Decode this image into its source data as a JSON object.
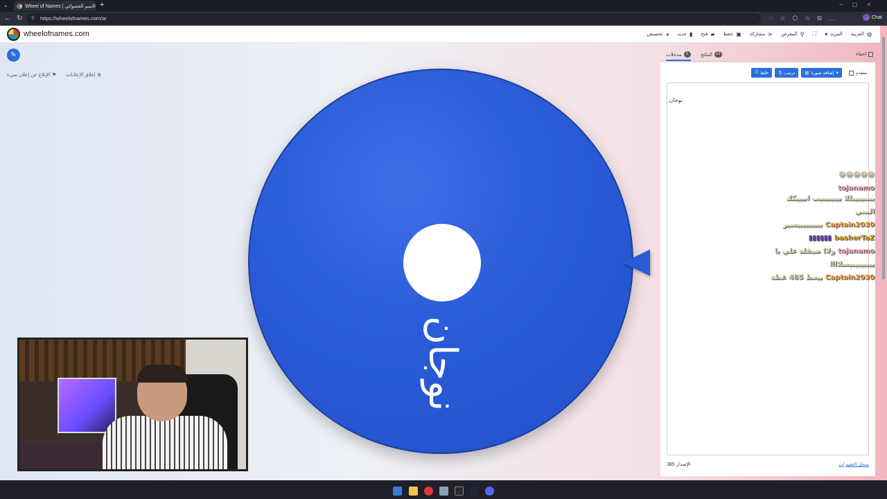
{
  "browser": {
    "tab_title": "Wheel of Names | الاسم العشوائي",
    "url": "https://wheelofnames.com/ar",
    "chat_label": "Chat"
  },
  "site": {
    "brand": "wheelofnames.com",
    "menu": [
      "تخصيص",
      "جديد",
      "فتح",
      "حفظ",
      "مشاركة",
      "المعرض",
      "المزيد",
      "العربية"
    ],
    "ad_close": "إغلاق الإعلانات",
    "ad_report": "الإبلاغ عن إعلان سيء"
  },
  "wheel": {
    "entry_label": "نوجان",
    "color": "#2a5bd7"
  },
  "panel": {
    "tab_entries": "مدخلات",
    "tab_entries_count": "1",
    "tab_results": "النتائج",
    "tab_results_count": "15",
    "hide_label": "إخفاء",
    "shuffle": "خلط",
    "sort": "ترتيب",
    "add_image": "إضافة صورة",
    "advanced": "متقدم",
    "entry_text": "نوجان",
    "version_label": "الإصدار",
    "version": "385",
    "changelog": "سجل التغييرات"
  },
  "chat": [
    {
      "user": "",
      "text": "😀😀😀😀😀"
    },
    {
      "user": "tojanamo",
      "text": "يبببيبيبللا ييبيبيبيب ابيييكك"
    },
    {
      "user": "",
      "text": "المني"
    },
    {
      "user": "Captain2030",
      "text": "يييييييييسير"
    },
    {
      "user": "basherTaZ",
      "text": "▮▮▮▮▮▮"
    },
    {
      "user": "tojanamo",
      "text": "ولاا صيقلة علي يا"
    },
    {
      "user": "",
      "text": "ييبييبيبيسلاااا"
    },
    {
      "user": "Captain2030",
      "text": "ييعط 485 غطة"
    }
  ]
}
